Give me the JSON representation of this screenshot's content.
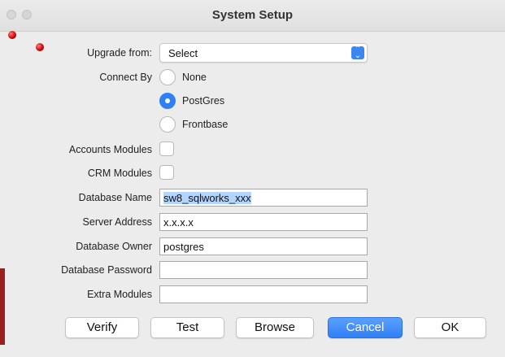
{
  "window": {
    "title": "System Setup"
  },
  "form": {
    "upgrade_label": "Upgrade from:",
    "upgrade_value": "Select",
    "connect_label": "Connect By",
    "radio_options": [
      {
        "label": "None",
        "selected": false
      },
      {
        "label": "PostGres",
        "selected": true
      },
      {
        "label": "Frontbase",
        "selected": false
      }
    ],
    "accounts_label": "Accounts Modules",
    "accounts_checked": false,
    "crm_label": "CRM Modules",
    "crm_checked": false,
    "db_name_label": "Database Name",
    "db_name_value": "sw8_sqlworks_xxx",
    "server_label": "Server Address",
    "server_value": "x.x.x.x",
    "owner_label": "Database Owner",
    "owner_value": "postgres",
    "password_label": "Database Password",
    "password_value": "",
    "extra_label": "Extra Modules",
    "extra_value": ""
  },
  "buttons": {
    "verify": "Verify",
    "test": "Test",
    "browse": "Browse",
    "cancel": "Cancel",
    "ok": "OK"
  },
  "colors": {
    "accent": "#2f7ff5",
    "marker_red": "#c80000",
    "selection": "#b3d4fc"
  }
}
